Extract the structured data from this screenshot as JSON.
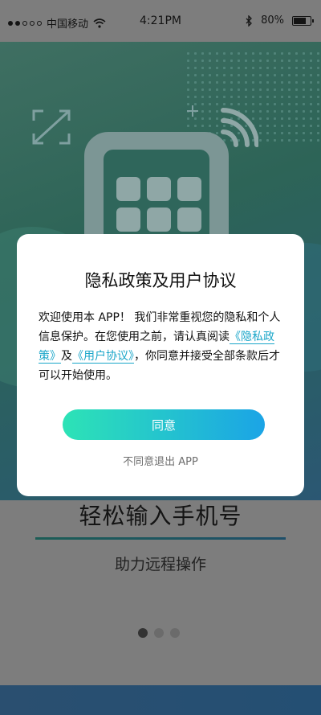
{
  "status_bar": {
    "carrier": "中国移动",
    "time": "4:21PM",
    "battery": "80%",
    "battery_level": 0.8
  },
  "onboarding": {
    "headline": "轻松输入手机号",
    "subline": "助力远程操作",
    "page_count": 3,
    "active_page": 0
  },
  "dialog": {
    "title": "隐私政策及用户协议",
    "body_part1": "欢迎使用本 APP！ 我们非常重视您的隐私和个人信息保护。在您使用之前，请认真阅读",
    "privacy_link": "《隐私政策》",
    "connector": "及",
    "terms_link": "《用户协议》",
    "body_part2": "，你同意并接受全部条款后才可以开始使用。",
    "agree_label": "同意",
    "decline_label": "不同意退出 APP"
  },
  "colors": {
    "accent_start": "#2de3b6",
    "accent_end": "#1ba4e6",
    "link": "#1aa6c9"
  }
}
